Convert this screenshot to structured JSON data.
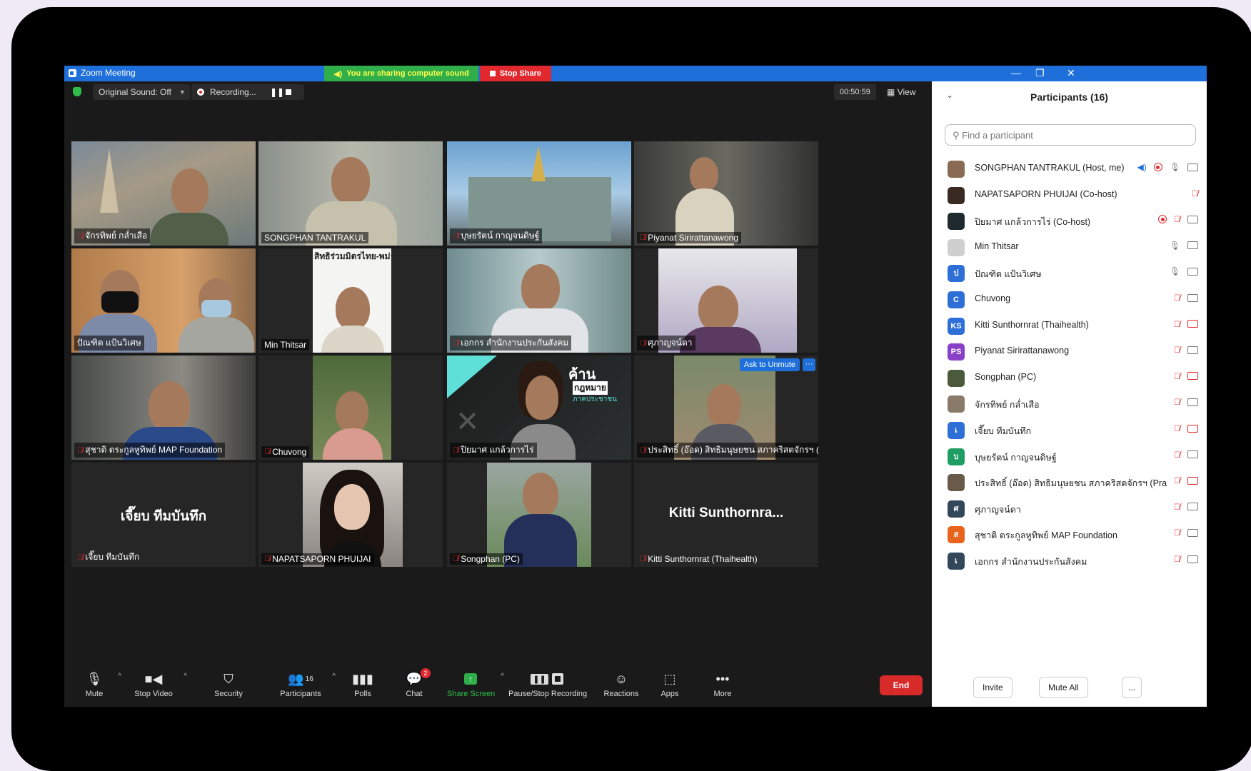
{
  "window": {
    "title": "Zoom Meeting",
    "sharing_text": "You are sharing computer sound",
    "stop_share": "Stop Share"
  },
  "topbar": {
    "original_sound": "Original Sound: Off",
    "recording": "Recording...",
    "timer": "00:50:59",
    "view": "View"
  },
  "tiles": [
    {
      "name": "จักรทิพย์ กล่ำเสือ",
      "muted": true
    },
    {
      "name": "SONGPHAN TANTRAKUL",
      "muted": false
    },
    {
      "name": "บุษยรัตน์ กาญจนดิษฐ์",
      "muted": true
    },
    {
      "name": "Piyanat Sirirattanawong",
      "muted": true
    },
    {
      "name": "ปัณฑิต แป้นวิเศษ",
      "muted": false
    },
    {
      "name": "Min Thitsar",
      "muted": false
    },
    {
      "name": "เอกกร สำนักงานประกันสังคม",
      "muted": true
    },
    {
      "name": "ศุภาญจน์ดา",
      "muted": true
    },
    {
      "name": "สุชาติ ตระกูลหูทิพย์ MAP Foundation",
      "muted": true
    },
    {
      "name": "Chuvong",
      "muted": true
    },
    {
      "name": "ปิยมาศ แกล้วการไร่",
      "muted": true
    },
    {
      "name": "ประสิทธิ์ (อ๊อด) สิทธิมนุษยชน สภาคริสตจักรฯ (Pra...",
      "muted": true
    },
    {
      "name": "เจี๊ยบ ทีมบันทึก",
      "muted": true,
      "big": "เจี๊ยบ ทีมบันทึก"
    },
    {
      "name": "NAPATSAPORN PHUIJAI",
      "muted": true
    },
    {
      "name": "Songphan (PC)",
      "muted": true
    },
    {
      "name": "Kitti Sunthornrat (Thaihealth)",
      "muted": true,
      "big": "Kitti Sunthornra..."
    }
  ],
  "ask_to_unmute": "Ask to Unmute",
  "more_dots": "···",
  "tile6_banner": "สิทธิร่วมมิตรไทย-พม่า(มร",
  "tile11_poster": {
    "line1": "ค้าน",
    "line2": "กฎหมาย",
    "line3": "ภาคประชาชน"
  },
  "toolbar": {
    "mute": "Mute",
    "stop_video": "Stop Video",
    "security": "Security",
    "participants": "Participants",
    "participants_count": "16",
    "polls": "Polls",
    "chat": "Chat",
    "chat_badge": "2",
    "share_screen": "Share Screen",
    "pause_stop_recording": "Pause/Stop Recording",
    "reactions": "Reactions",
    "apps": "Apps",
    "more": "More",
    "end": "End"
  },
  "panel": {
    "title": "Participants (16)",
    "search_placeholder": "Find a participant",
    "invite": "Invite",
    "mute_all": "Mute All",
    "more": "..."
  },
  "participants": [
    {
      "name": "SONGPHAN TANTRAKUL (Host, me)",
      "avatar": "",
      "color": "#8a6a55",
      "status": "unmuted-speaking"
    },
    {
      "name": "NAPATSAPORN PHUIJAI (Co-host)",
      "avatar": "",
      "color": "#3a2a24",
      "status": "muted"
    },
    {
      "name": "ปิยมาศ แกล้วการไร่ (Co-host)",
      "avatar": "",
      "color": "#1f2a2e",
      "status": "muted"
    },
    {
      "name": "Min Thitsar",
      "avatar": "",
      "color": "#cfcfcf",
      "status": "unmuted"
    },
    {
      "name": "ปัณฑิต แป้นวิเศษ",
      "avatar": "ป",
      "color": "#2d6fd6",
      "status": "unmuted"
    },
    {
      "name": "Chuvong",
      "avatar": "C",
      "color": "#2d6fd6",
      "status": "muted"
    },
    {
      "name": "Kitti Sunthornrat (Thaihealth)",
      "avatar": "KS",
      "color": "#2d6fd6",
      "status": "muted-novideo"
    },
    {
      "name": "Piyanat Sirirattanawong",
      "avatar": "PS",
      "color": "#8a3fc7",
      "status": "muted"
    },
    {
      "name": "Songphan (PC)",
      "avatar": "",
      "color": "#4b5a3a",
      "status": "muted-novideo"
    },
    {
      "name": "จักรทิพย์ กล่ำเสือ",
      "avatar": "",
      "color": "#8a7a6a",
      "status": "muted"
    },
    {
      "name": "เจี๊ยบ ทีมบันทึก",
      "avatar": "เ",
      "color": "#2d6fd6",
      "status": "muted-novideo"
    },
    {
      "name": "บุษยรัตน์ กาญจนดิษฐ์",
      "avatar": "บ",
      "color": "#1e9e63",
      "status": "muted"
    },
    {
      "name": "ประสิทธิ์ (อ๊อด) สิทธิมนุษยชน สภาคริสตจักรฯ (Pra...",
      "avatar": "",
      "color": "#6a5a4a",
      "status": "muted-novideo"
    },
    {
      "name": "ศุภาญจน์ดา",
      "avatar": "ศ",
      "color": "#33475b",
      "status": "muted"
    },
    {
      "name": "สุชาติ ตระกูลหูทิพย์ MAP Foundation",
      "avatar": "ส",
      "color": "#e8641e",
      "status": "muted"
    },
    {
      "name": "เอกกร สำนักงานประกันสังคม",
      "avatar": "เ",
      "color": "#33475b",
      "status": "muted"
    }
  ]
}
